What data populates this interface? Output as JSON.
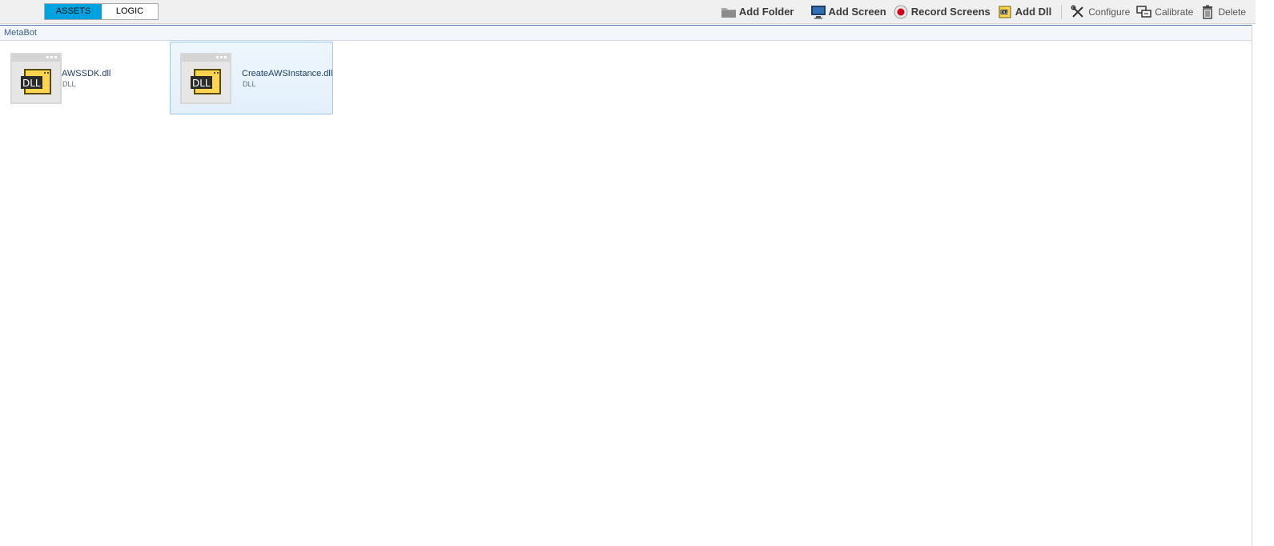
{
  "tabs": {
    "assets_label": "ASSETS",
    "logic_label": "LOGIC"
  },
  "toolbar": {
    "add_folder": "Add Folder",
    "add_screen": "Add Screen",
    "record_screens": "Record Screens",
    "add_dll": "Add Dll",
    "configure": "Configure",
    "calibrate": "Calibrate",
    "delete": "Delete"
  },
  "breadcrumb": {
    "root": "MetaBot"
  },
  "assets": [
    {
      "name": "AWSSDK.dll",
      "type": "DLL",
      "icon": "dll-file-icon",
      "selected": false
    },
    {
      "name": "CreateAWSInstance.dll",
      "type": "DLL",
      "icon": "dll-file-icon",
      "selected": true
    }
  ],
  "colors": {
    "accent": "#00a2e0",
    "selection_border": "#9fc8ea",
    "dll_yellow": "#ffd54f",
    "record_red": "#d0021b"
  }
}
